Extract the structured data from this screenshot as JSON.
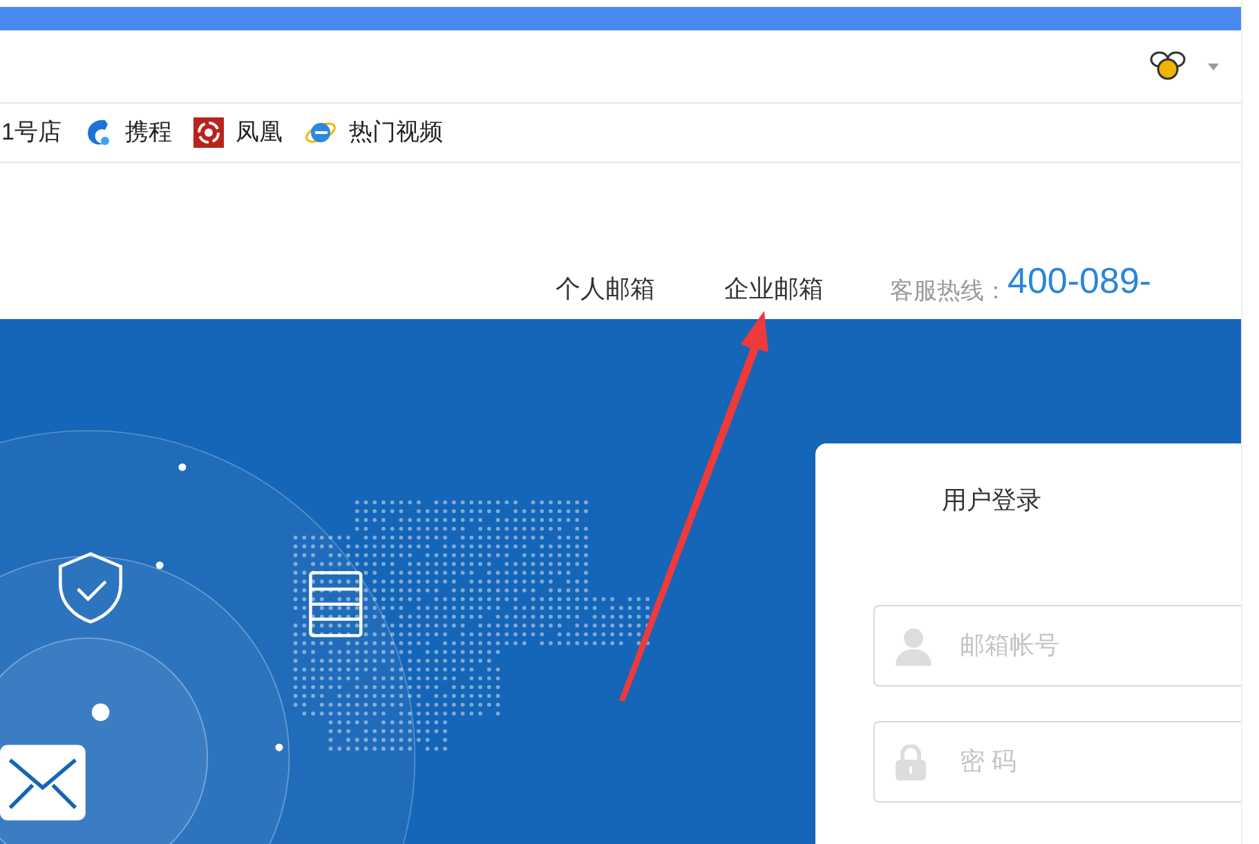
{
  "bookmarks": [
    {
      "kind": "none",
      "label": "1号店"
    },
    {
      "kind": "dolphin",
      "label": "携程"
    },
    {
      "kind": "swirl",
      "label": "凤凰"
    },
    {
      "kind": "globe",
      "label": "热门视频"
    }
  ],
  "nav": [
    {
      "label": "个人邮箱"
    },
    {
      "label": "企业邮箱"
    }
  ],
  "hotline": {
    "label": "客服热线：",
    "number": "400-089-"
  },
  "login": {
    "title": "用户登录",
    "fields": [
      {
        "kind": "user",
        "placeholder": "邮箱帐号"
      },
      {
        "kind": "password",
        "placeholder": "密 码"
      }
    ]
  }
}
